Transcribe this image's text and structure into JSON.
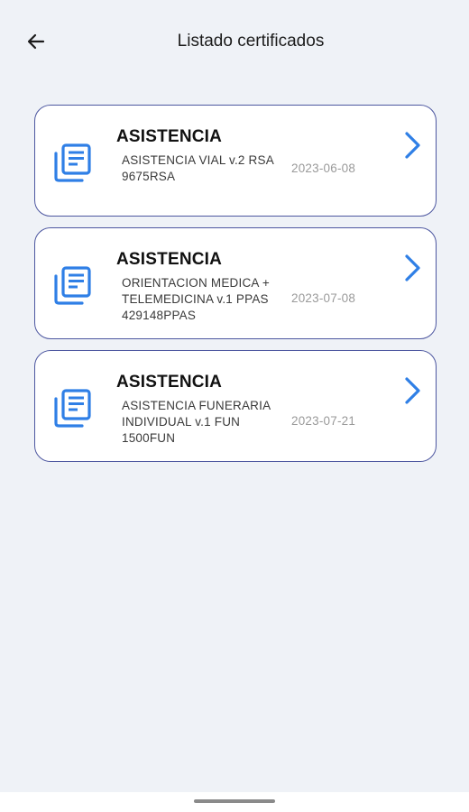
{
  "header": {
    "title": "Listado certificados",
    "back_icon": "arrow-left-icon"
  },
  "certificates": [
    {
      "title": "ASISTENCIA",
      "description": "ASISTENCIA VIAL v.2 RSA 9675RSA",
      "date": "2023-06-08"
    },
    {
      "title": "ASISTENCIA",
      "description": "ORIENTACION MEDICA + TELEMEDICINA v.1 PPAS 429148PPAS",
      "date": "2023-07-08"
    },
    {
      "title": "ASISTENCIA",
      "description": "ASISTENCIA FUNERARIA INDIVIDUAL v.1 FUN 1500FUN",
      "date": "2023-07-21"
    }
  ],
  "colors": {
    "accent": "#2f7fe6",
    "card_border": "#4d57a0",
    "background": "#eff2f7"
  }
}
